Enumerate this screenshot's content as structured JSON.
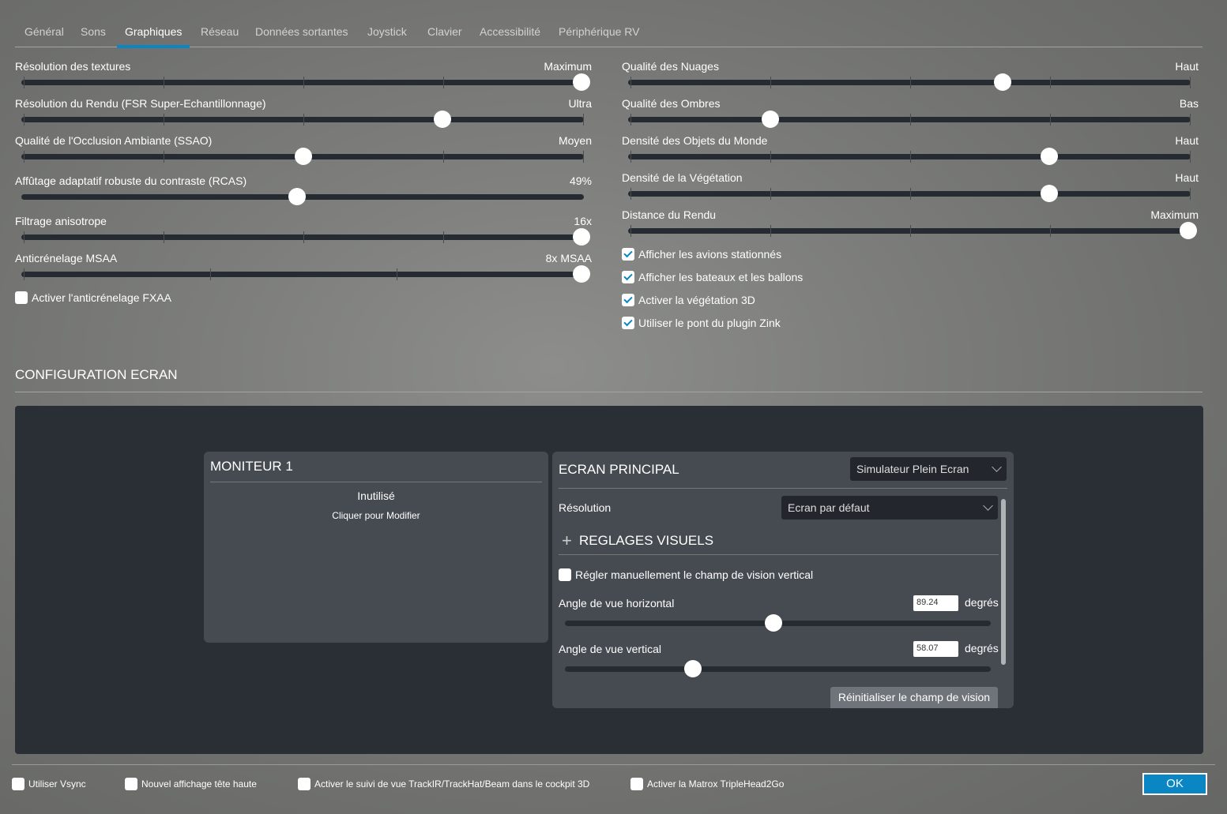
{
  "tabs": [
    "Général",
    "Sons",
    "Graphiques",
    "Réseau",
    "Données sortantes",
    "Joystick",
    "Clavier",
    "Accessibilité",
    "Périphérique RV"
  ],
  "active_tab": "Graphiques",
  "left_sliders": [
    {
      "label": "Résolution des textures",
      "value": "Maximum",
      "fraction": 1.0,
      "ticks": 5
    },
    {
      "label": "Résolution du Rendu (FSR Super-Echantillonnage)",
      "value": "Ultra",
      "fraction": 0.75,
      "ticks": 5
    },
    {
      "label": "Qualité de l'Occlusion Ambiante (SSAO)",
      "value": "Moyen",
      "fraction": 0.5,
      "ticks": 5
    },
    {
      "label": "Affûtage adaptatif robuste du contraste (RCAS)",
      "value": "49%",
      "fraction": 0.49,
      "ticks": 0
    },
    {
      "label": "Filtrage anisotrope",
      "value": "16x",
      "fraction": 1.0,
      "ticks": 5
    },
    {
      "label": "Anticrénelage MSAA",
      "value": "8x MSAA",
      "fraction": 1.0,
      "ticks": 4
    }
  ],
  "fxaa": {
    "label": "Activer l'anticrénelage FXAA",
    "checked": false
  },
  "right_sliders": [
    {
      "label": "Qualité des Nuages",
      "value": "Haut",
      "fraction": 0.667,
      "ticks": 5
    },
    {
      "label": "Qualité des Ombres",
      "value": "Bas",
      "fraction": 0.25,
      "ticks": 5
    },
    {
      "label": "Densité des Objets du Monde",
      "value": "Haut",
      "fraction": 0.75,
      "ticks": 5
    },
    {
      "label": "Densité de la Végétation",
      "value": "Haut",
      "fraction": 0.75,
      "ticks": 5
    },
    {
      "label": "Distance du Rendu",
      "value": "Maximum",
      "fraction": 1.0,
      "ticks": 5
    }
  ],
  "right_checks": [
    {
      "label": "Afficher les avions stationnés",
      "checked": true
    },
    {
      "label": "Afficher les bateaux et les ballons",
      "checked": true
    },
    {
      "label": "Activer la végétation 3D",
      "checked": true
    },
    {
      "label": "Utiliser le pont du plugin Zink",
      "checked": true
    }
  ],
  "section_title": "CONFIGURATION ECRAN",
  "monitor": {
    "title": "MONITEUR 1",
    "status": "Inutilisé",
    "hint": "Cliquer pour Modifier"
  },
  "ecran": {
    "title": "ECRAN PRINCIPAL",
    "mode": "Simulateur Plein Ecran",
    "resolution_label": "Résolution",
    "resolution": "Ecran par défaut",
    "visual_title": "REGLAGES VISUELS",
    "manual_fov": {
      "label": "Régler manuellement le champ de vision vertical",
      "checked": false
    },
    "hfov": {
      "label": "Angle de vue horizontal",
      "value": "89.24",
      "unit": "degrés",
      "fraction": 0.49
    },
    "vfov": {
      "label": "Angle de vue vertical",
      "value": "58.07",
      "unit": "degrés",
      "fraction": 0.3
    },
    "reset": "Réinitialiser le champ de vision"
  },
  "bottom_checks": [
    {
      "label": "Utiliser Vsync",
      "checked": false
    },
    {
      "label": "Nouvel affichage tête haute",
      "checked": false
    },
    {
      "label": "Activer le suivi de vue TrackIR/TrackHat/Beam dans le cockpit 3D",
      "checked": false
    },
    {
      "label": "Activer la Matrox TripleHead2Go",
      "checked": false
    }
  ],
  "ok": "OK",
  "colors": {
    "accent": "#0a86c4",
    "panel": "#2a2e35",
    "card": "#464b52"
  }
}
